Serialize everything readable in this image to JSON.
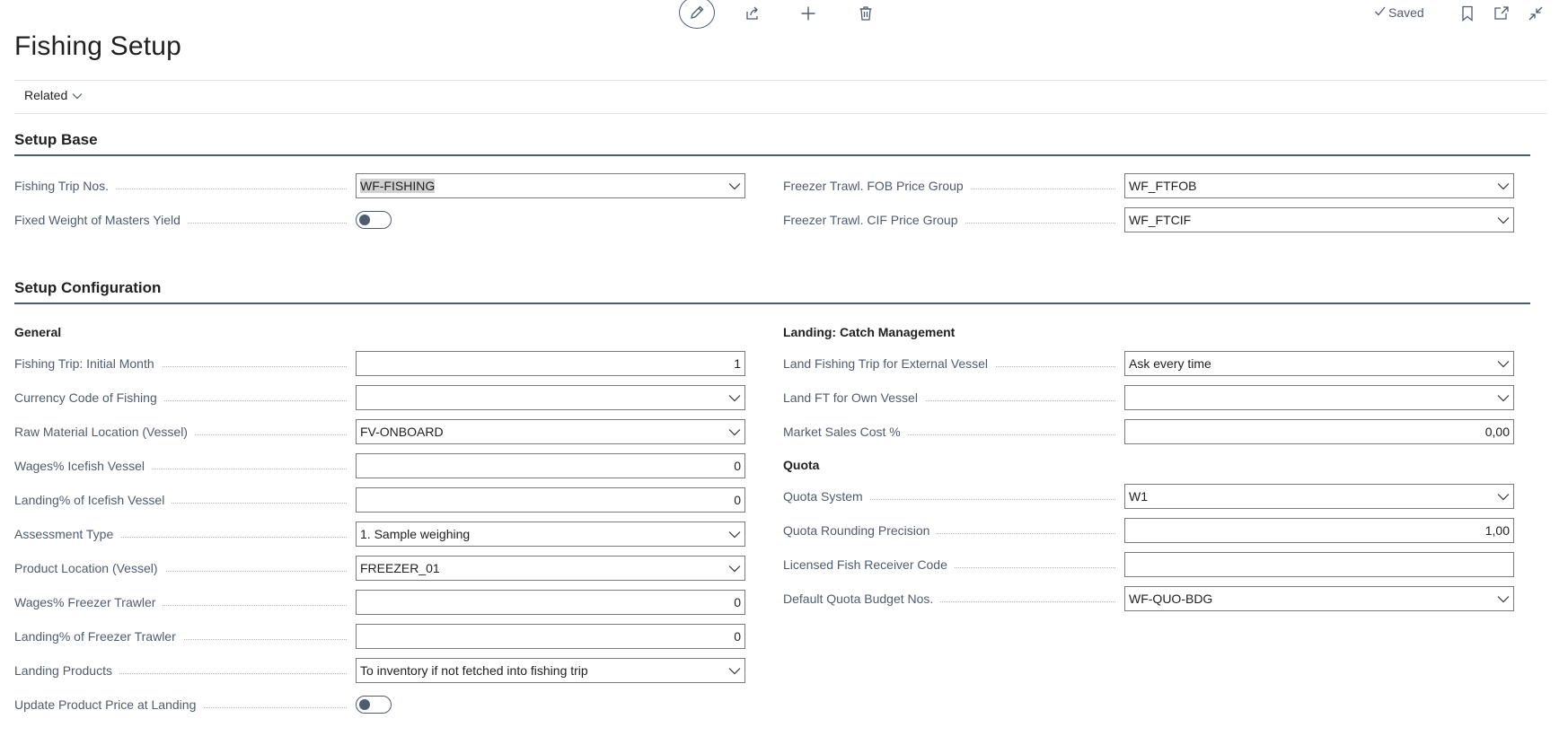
{
  "header": {
    "title": "Fishing Setup",
    "saved_label": "Saved",
    "related_label": "Related"
  },
  "sections": {
    "setup_base": "Setup Base",
    "setup_configuration": "Setup Configuration"
  },
  "setup_base": {
    "left": [
      {
        "label": "Fishing Trip Nos.",
        "value": "WF-FISHING",
        "type": "dropdown"
      },
      {
        "label": "Fixed Weight of Masters Yield",
        "value": false,
        "type": "toggle"
      }
    ],
    "right": [
      {
        "label": "Freezer Trawl. FOB Price Group",
        "value": "WF_FTFOB",
        "type": "dropdown"
      },
      {
        "label": "Freezer Trawl. CIF Price Group",
        "value": "WF_FTCIF",
        "type": "dropdown"
      }
    ]
  },
  "general": {
    "title": "General",
    "fields": [
      {
        "label": "Fishing Trip: Initial Month",
        "value": "1",
        "type": "number"
      },
      {
        "label": "Currency Code of Fishing",
        "value": "",
        "type": "dropdown"
      },
      {
        "label": "Raw Material Location (Vessel)",
        "value": "FV-ONBOARD",
        "type": "dropdown"
      },
      {
        "label": "Wages% Icefish Vessel",
        "value": "0",
        "type": "number"
      },
      {
        "label": "Landing% of Icefish Vessel",
        "value": "0",
        "type": "number"
      },
      {
        "label": "Assessment Type",
        "value": "1. Sample weighing",
        "type": "dropdown"
      },
      {
        "label": "Product Location (Vessel)",
        "value": "FREEZER_01",
        "type": "dropdown"
      },
      {
        "label": "Wages% Freezer Trawler",
        "value": "0",
        "type": "number"
      },
      {
        "label": "Landing% of Freezer Trawler",
        "value": "0",
        "type": "number"
      },
      {
        "label": "Landing Products",
        "value": "To inventory if not fetched into fishing trip",
        "type": "dropdown"
      },
      {
        "label": "Update Product Price at Landing",
        "value": false,
        "type": "toggle"
      }
    ]
  },
  "landing": {
    "title": "Landing: Catch Management",
    "fields": [
      {
        "label": "Land Fishing Trip for External Vessel",
        "value": "Ask every time",
        "type": "dropdown"
      },
      {
        "label": "Land FT for Own Vessel",
        "value": "",
        "type": "dropdown"
      },
      {
        "label": "Market Sales Cost %",
        "value": "0,00",
        "type": "number"
      }
    ]
  },
  "quota": {
    "title": "Quota",
    "fields": [
      {
        "label": "Quota System",
        "value": "W1",
        "type": "dropdown"
      },
      {
        "label": "Quota Rounding Precision",
        "value": "1,00",
        "type": "number"
      },
      {
        "label": "Licensed Fish Receiver Code",
        "value": "",
        "type": "text"
      },
      {
        "label": "Default Quota Budget Nos.",
        "value": "WF-QUO-BDG",
        "type": "dropdown"
      }
    ]
  },
  "icons": {
    "edit": "pencil-icon",
    "share": "share-icon",
    "new": "plus-icon",
    "delete": "trash-icon",
    "saved": "checkmark-icon",
    "bookmark": "bookmark-icon",
    "popout": "open-in-new-window-icon",
    "collapse": "collapse-icon",
    "dropdown": "chevron-down-icon"
  },
  "colors": {
    "accent": "#4a5b74",
    "label": "#505c6d",
    "text": "#212121",
    "field_border": "#7a7a7a",
    "selection": "#d1d1d1"
  }
}
